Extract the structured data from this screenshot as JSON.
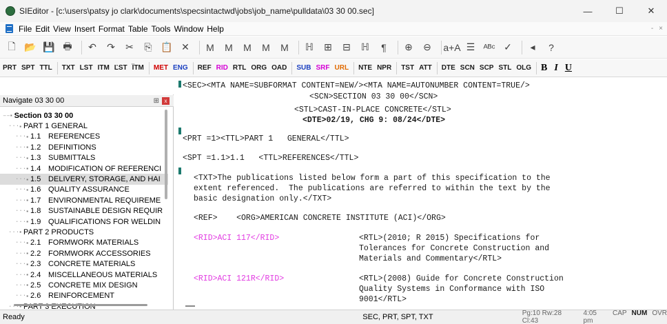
{
  "window": {
    "title": "SIEditor - [c:\\users\\patsy jo clark\\documents\\specsintactwd\\jobs\\job_name\\pulldata\\03 30 00.sec]",
    "minimize": "—",
    "maximize": "☐",
    "close": "✕"
  },
  "menu": {
    "items": [
      "File",
      "Edit",
      "View",
      "Insert",
      "Format",
      "Table",
      "Tools",
      "Window",
      "Help"
    ],
    "right_minimize": "-",
    "right_close": "×"
  },
  "toolbar1": {
    "icons": [
      "new-doc",
      "open-folder",
      "save",
      "print",
      "undo",
      "redo",
      "cut",
      "copy",
      "paste",
      "delete",
      "find",
      "find-next",
      "find-prev",
      "binoculars-2",
      "binoculars-3",
      "strike",
      "zoom-fit",
      "zoom-page",
      "track",
      "pilcrow",
      "zoom-in",
      "zoom-out",
      "font-size",
      "align",
      "spell",
      "check",
      "arrow-left",
      "help"
    ],
    "glyphs": [
      "🗋",
      "📂",
      "💾",
      "🖶",
      "↶",
      "↷",
      "✂",
      "⎘",
      "📋",
      "✕",
      "M",
      "M",
      "M",
      "M",
      "M",
      "ℍ",
      "⊞",
      "⊟",
      "ℍ",
      "¶",
      "⊕",
      "⊖",
      "a+A",
      "☰",
      "ᴬᴮᶜ",
      "✓",
      "◂",
      "?"
    ]
  },
  "toolbar2": {
    "tags": [
      {
        "label": "PRT",
        "color": "black"
      },
      {
        "label": "SPT",
        "color": "black"
      },
      {
        "label": "TTL",
        "color": "black"
      },
      {
        "label": "TXT",
        "color": "black"
      },
      {
        "label": "LST",
        "color": "black"
      },
      {
        "label": "ITM",
        "color": "black"
      },
      {
        "label": "ĽST",
        "color": "black"
      },
      {
        "label": "ÏTM",
        "color": "black"
      },
      {
        "label": "MET",
        "color": "red"
      },
      {
        "label": "ENG",
        "color": "blue"
      },
      {
        "label": "REF",
        "color": "black"
      },
      {
        "label": "RID",
        "color": "magenta"
      },
      {
        "label": "RTL",
        "color": "black"
      },
      {
        "label": "ORG",
        "color": "black"
      },
      {
        "label": "OAD",
        "color": "black"
      },
      {
        "label": "SUB",
        "color": "blue"
      },
      {
        "label": "SRF",
        "color": "magenta"
      },
      {
        "label": "URL",
        "color": "orange"
      },
      {
        "label": "NTE",
        "color": "black"
      },
      {
        "label": "NPR",
        "color": "black"
      },
      {
        "label": "TST",
        "color": "black"
      },
      {
        "label": "ATT",
        "color": "black"
      },
      {
        "label": "DTE",
        "color": "black"
      },
      {
        "label": "SCN",
        "color": "black"
      },
      {
        "label": "SCP",
        "color": "black"
      },
      {
        "label": "STL",
        "color": "black"
      },
      {
        "label": "OLG",
        "color": "black"
      }
    ],
    "format": [
      "B",
      "I",
      "U"
    ]
  },
  "navigator": {
    "title": "Navigate 03 30 00",
    "pin": "⊞",
    "close": "x",
    "items": [
      {
        "num": "",
        "label": "Section 03 30 00",
        "level": 0,
        "bold": true
      },
      {
        "num": "",
        "label": "PART 1  GENERAL",
        "level": 1
      },
      {
        "num": "1.1",
        "label": "REFERENCES",
        "level": 2
      },
      {
        "num": "1.2",
        "label": "DEFINITIONS",
        "level": 2
      },
      {
        "num": "1.3",
        "label": "SUBMITTALS",
        "level": 2
      },
      {
        "num": "1.4",
        "label": "MODIFICATION OF REFERENCI",
        "level": 2
      },
      {
        "num": "1.5",
        "label": "DELIVERY, STORAGE, AND HAI",
        "level": 2,
        "selected": true
      },
      {
        "num": "1.6",
        "label": "QUALITY ASSURANCE",
        "level": 2
      },
      {
        "num": "1.7",
        "label": "ENVIRONMENTAL REQUIREME",
        "level": 2
      },
      {
        "num": "1.8",
        "label": "SUSTAINABLE DESIGN REQUIR",
        "level": 2
      },
      {
        "num": "1.9",
        "label": "QUALIFICATIONS FOR WELDIN",
        "level": 2
      },
      {
        "num": "",
        "label": "PART 2  PRODUCTS",
        "level": 1
      },
      {
        "num": "2.1",
        "label": "FORMWORK MATERIALS",
        "level": 2
      },
      {
        "num": "2.2",
        "label": "FORMWORK ACCESSORIES",
        "level": 2
      },
      {
        "num": "2.3",
        "label": "CONCRETE MATERIALS",
        "level": 2
      },
      {
        "num": "2.4",
        "label": "MISCELLANEOUS MATERIALS",
        "level": 2
      },
      {
        "num": "2.5",
        "label": "CONCRETE MIX DESIGN",
        "level": 2
      },
      {
        "num": "2.6",
        "label": "REINFORCEMENT",
        "level": 2
      },
      {
        "num": "",
        "label": "PART 3  EXECUTION",
        "level": 1
      }
    ]
  },
  "editor": {
    "lines": [
      {
        "text": "<SEC><MTA NAME=SUBFORMAT CONTENT=NEW/><MTA NAME=AUTONUMBER CONTENT=TRUE/>",
        "indent": 0,
        "style": ""
      },
      {
        "text": "<SCN>SECTION 03 30 00</SCN>",
        "indent": 184,
        "style": ""
      },
      {
        "text": "<STL>CAST-IN-PLACE CONCRETE</STL>",
        "indent": 162,
        "style": ""
      },
      {
        "text": "<DTE>02/19, CHG 9: 08/24</DTE>",
        "indent": 174,
        "style": "bold"
      },
      {
        "text": "<PRT =1><TTL>PART 1   GENERAL</TTL>",
        "indent": 0,
        "style": ""
      },
      {
        "text": "<SPT =1.1>1.1   <TTL>REFERENCES</TTL>",
        "indent": 0,
        "style": ""
      },
      {
        "text": "<TXT>The publications listed below form a part of this specification to the",
        "indent": 16,
        "style": ""
      },
      {
        "text": "extent referenced.  The publications are referred to within the text by the",
        "indent": 16,
        "style": ""
      },
      {
        "text": "basic designation only.</TXT>",
        "indent": 16,
        "style": ""
      },
      {
        "text": "<REF>    <ORG>AMERICAN CONCRETE INSTITUTE (ACI)</ORG>",
        "indent": 16,
        "style": ""
      },
      {
        "text": "<RID>ACI 117</RID>",
        "indent": 16,
        "style": "rid"
      },
      {
        "text": "<RTL>(2010; R 2015) Specifications for",
        "indent": 256,
        "style": ""
      },
      {
        "text": "Tolerances for Concrete Construction and",
        "indent": 256,
        "style": ""
      },
      {
        "text": "Materials and Commentary</RTL>",
        "indent": 256,
        "style": ""
      },
      {
        "text": "<RID>ACI 121R</RID>",
        "indent": 16,
        "style": "rid"
      },
      {
        "text": "<RTL>(2008) Guide for Concrete Construction",
        "indent": 256,
        "style": ""
      },
      {
        "text": "Quality Systems in Conformance with ISO",
        "indent": 256,
        "style": ""
      },
      {
        "text": "9001</RTL>",
        "indent": 256,
        "style": ""
      }
    ]
  },
  "status": {
    "ready": "Ready",
    "tags": "SEC, PRT, SPT, TXT",
    "position": "Pg:10 Rw:28 Cl:43",
    "time": "4:05 pm",
    "cap": "CAP",
    "num": "NUM",
    "ovr": "OVR"
  }
}
